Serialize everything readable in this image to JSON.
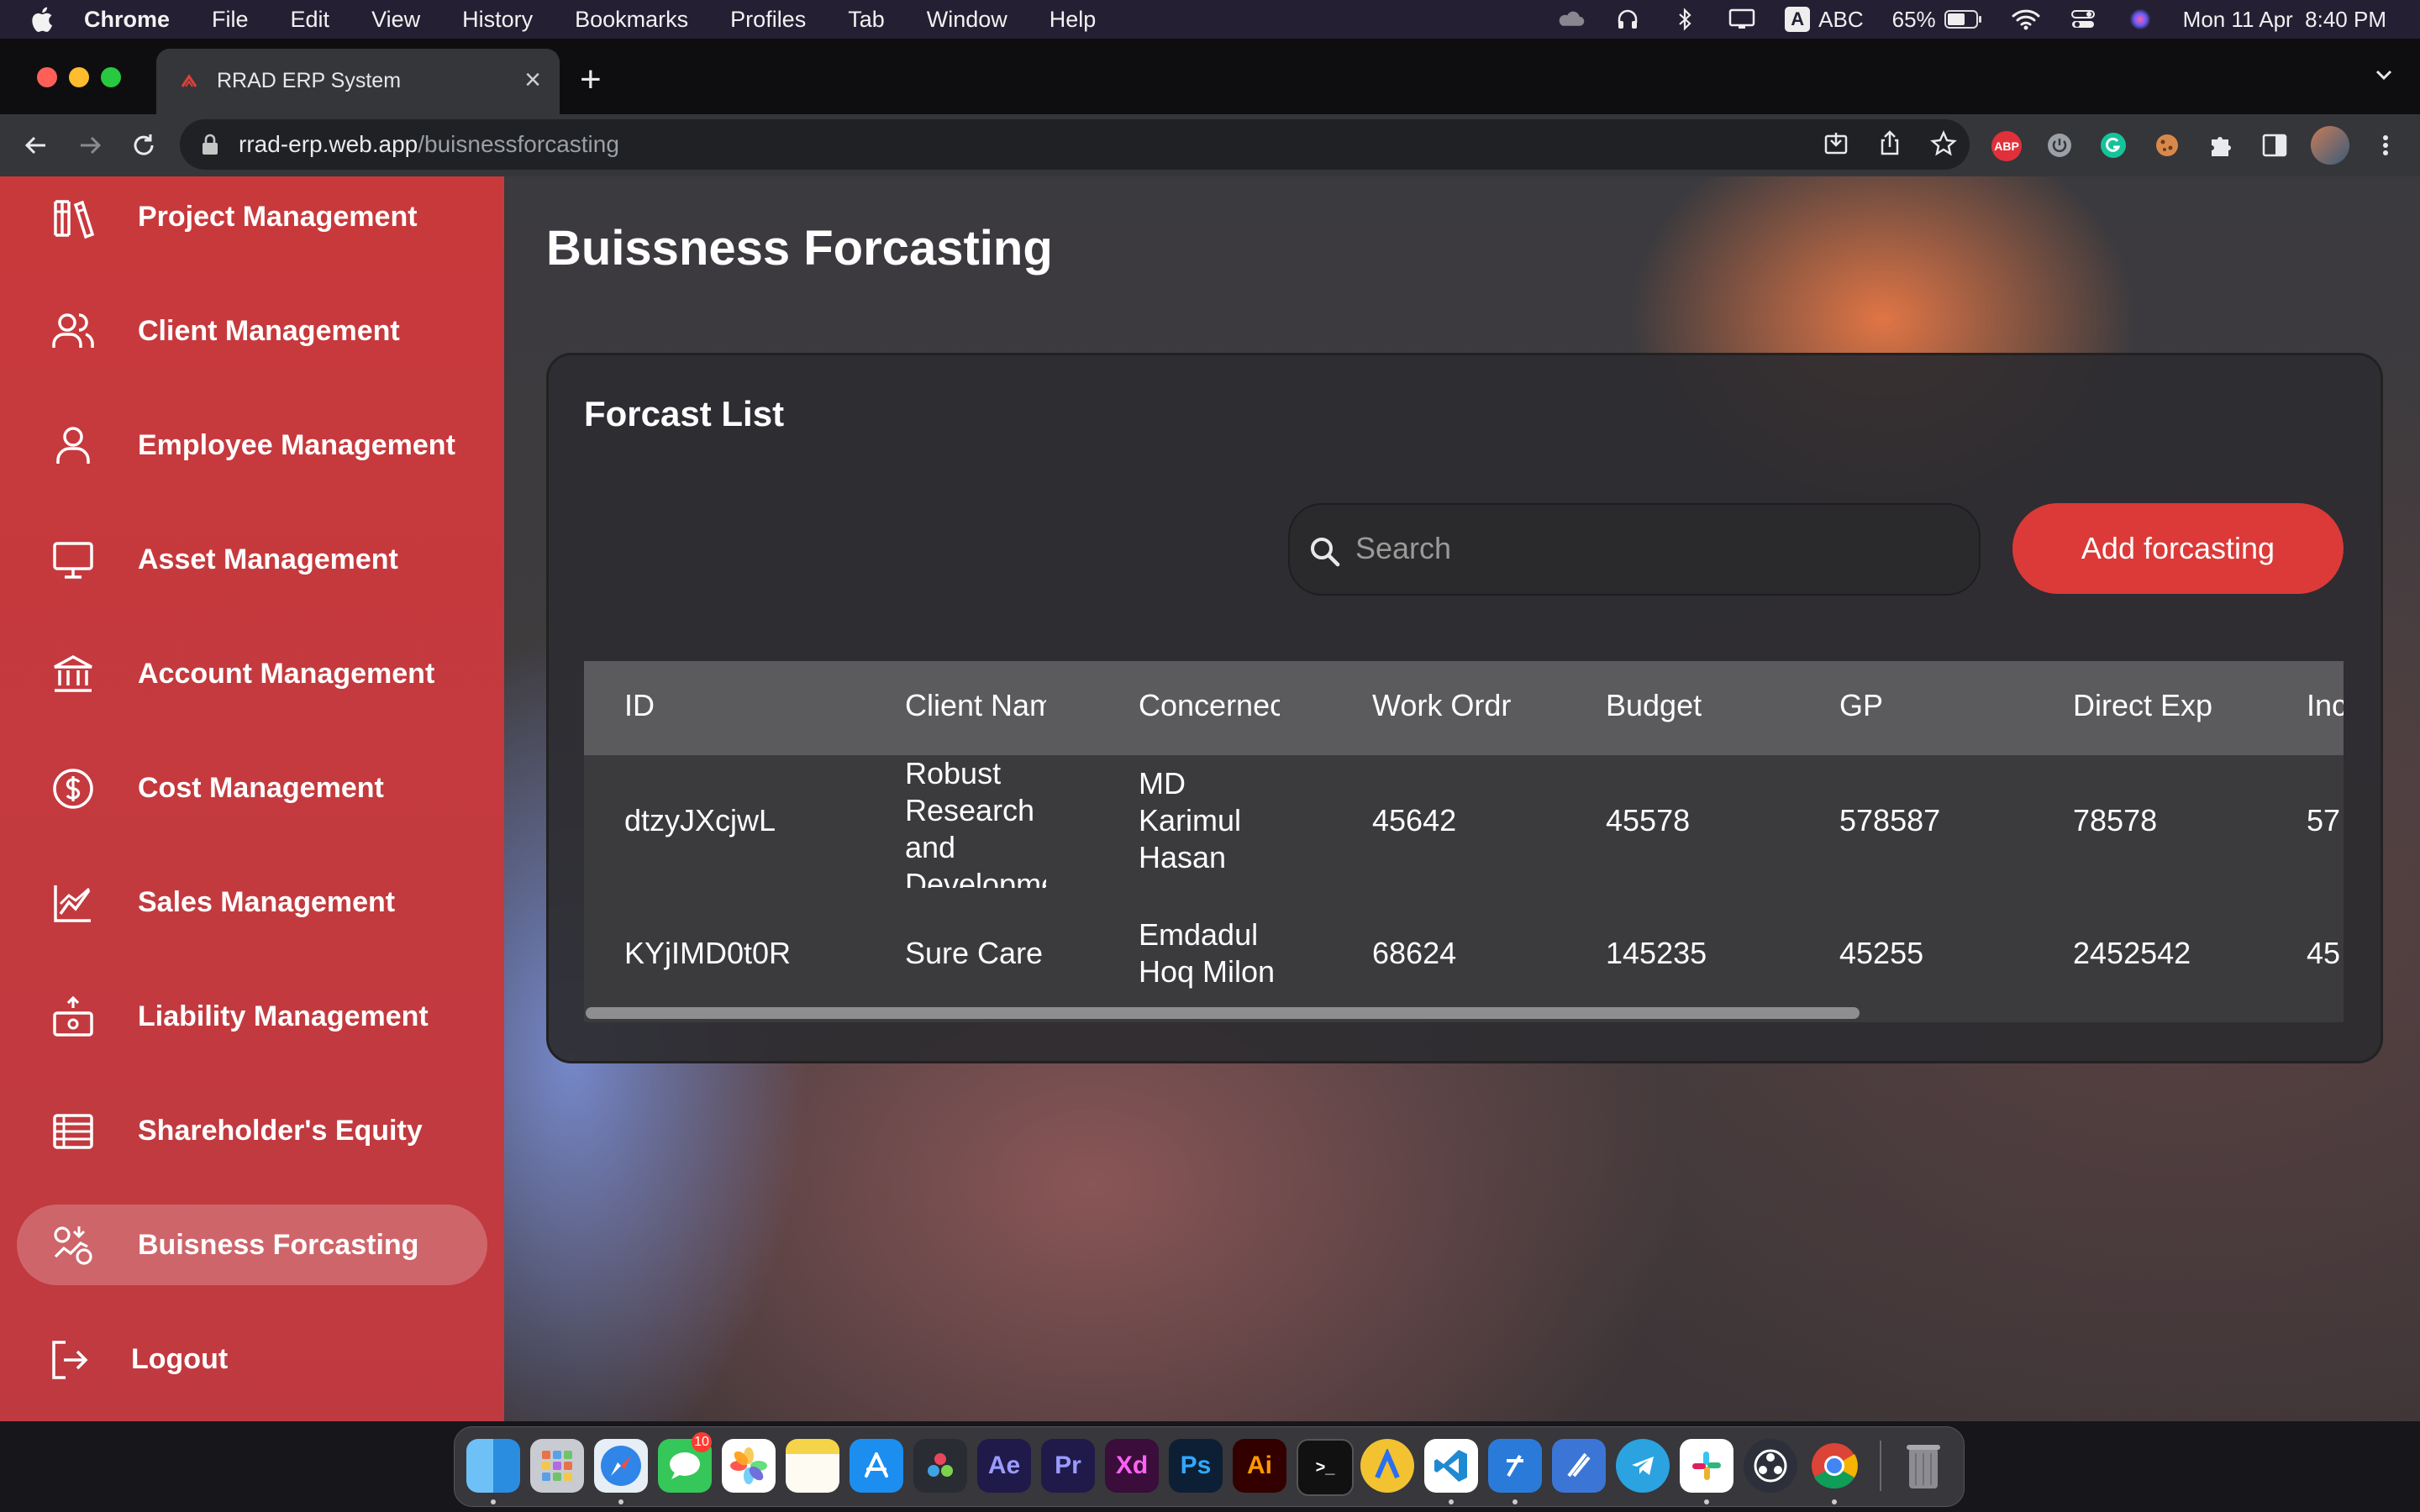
{
  "menubar": {
    "app": "Chrome",
    "items": [
      "File",
      "Edit",
      "View",
      "History",
      "Bookmarks",
      "Profiles",
      "Tab",
      "Window",
      "Help"
    ],
    "input_source": "ABC",
    "battery": "65%",
    "datetime": "Mon 11 Apr  8:40 PM"
  },
  "browser": {
    "tab_title": "RRAD ERP System",
    "url_host": "rrad-erp.web.app",
    "url_path": "/buisnessforcasting",
    "ext_abp": "ABP"
  },
  "sidebar": {
    "items": [
      {
        "label": "Project Management",
        "icon": "library-icon"
      },
      {
        "label": "Client Management",
        "icon": "users-icon"
      },
      {
        "label": "Employee Management",
        "icon": "user-icon"
      },
      {
        "label": "Asset Management",
        "icon": "monitor-icon"
      },
      {
        "label": "Account Management",
        "icon": "bank-icon"
      },
      {
        "label": "Cost Management",
        "icon": "dollar-circle-icon"
      },
      {
        "label": "Sales Management",
        "icon": "line-chart-icon"
      },
      {
        "label": "Liability Management",
        "icon": "liability-icon"
      },
      {
        "label": "Shareholder's Equity",
        "icon": "list-icon"
      },
      {
        "label": "Buisness Forcasting",
        "icon": "forecast-icon",
        "active": true
      },
      {
        "label": "Logout",
        "icon": "logout-icon"
      }
    ]
  },
  "page": {
    "title": "Buissness Forcasting",
    "card_title": "Forcast List",
    "search_placeholder": "Search",
    "add_button": "Add forcasting"
  },
  "table": {
    "columns": [
      "ID",
      "Client Nam",
      "Concernec",
      "Work Ordr",
      "Budget",
      "GP",
      "Direct Exp",
      "Inc"
    ],
    "rows": [
      [
        "dtzyJXcjwL",
        "Robust Research and Development",
        "MD Karimul Hasan",
        "45642",
        "45578",
        "578587",
        "78578",
        "57"
      ],
      [
        "KYjIMD0t0R",
        "Sure Care",
        "Emdadul Hoq Milon",
        "68624",
        "145235",
        "45255",
        "2452542",
        "45"
      ]
    ]
  },
  "dock": {
    "messages_badge": "10",
    "apps": [
      "Finder",
      "Launchpad",
      "Safari",
      "Messages",
      "Photos",
      "Notes",
      "App Store",
      "DaVinci Resolve",
      "Ae",
      "Pr",
      "Xd",
      "Ps",
      "Ai",
      "Terminal",
      "Arc",
      "VS Code",
      "Xcode",
      "Instruments",
      "Telegram",
      "Slack",
      "OBS",
      "Chrome",
      "Trash"
    ]
  },
  "colors": {
    "sidebar": "#c8393c",
    "accent_button": "#db3a38",
    "card": "#2d2c30"
  }
}
